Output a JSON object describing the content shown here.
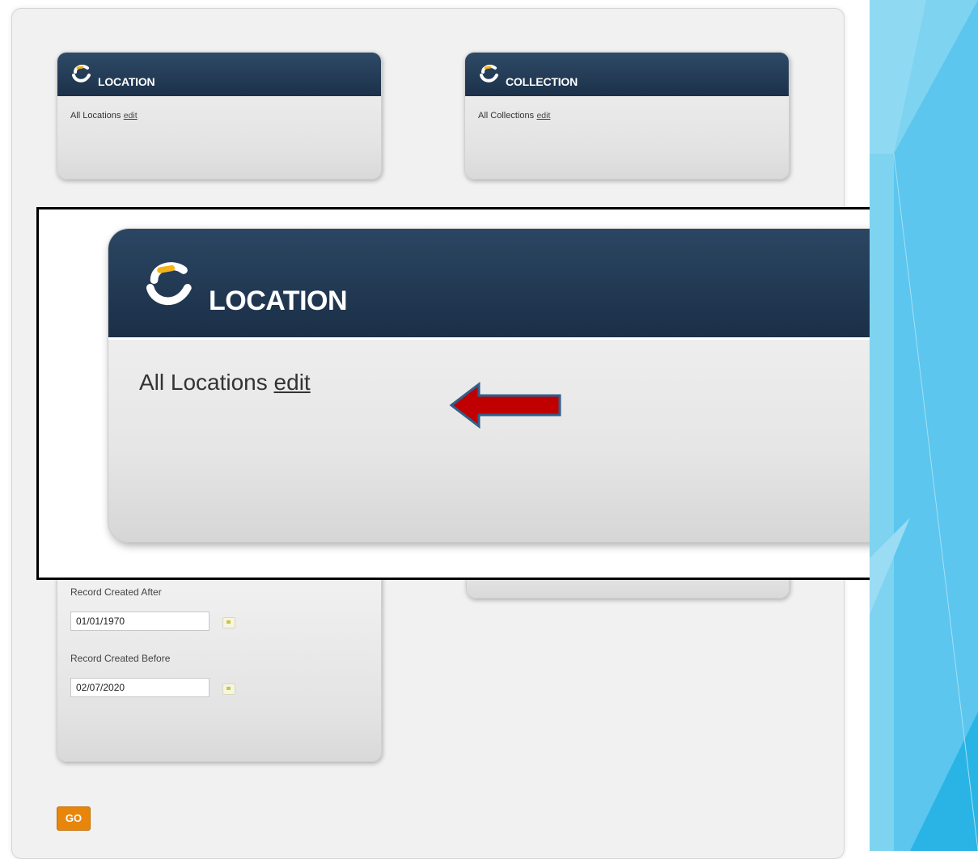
{
  "location_widget": {
    "title": "LOCATION",
    "text": "All Locations",
    "edit_label": "edit"
  },
  "collection_widget": {
    "title": "COLLECTION",
    "text": "All Collections",
    "edit_label": "edit"
  },
  "zoom_callout": {
    "title": "LOCATION",
    "text": "All Locations",
    "edit_label": "edit"
  },
  "dates": {
    "created_after_label": "Record Created After",
    "created_after_value": "01/01/1970",
    "created_before_label": "Record Created Before",
    "created_before_value": "02/07/2020"
  },
  "go_label": "GO",
  "colors": {
    "header": "#1f3550",
    "logo_accent": "#f2b21a",
    "arrow": "#c00000",
    "go_button": "#e8860c",
    "deco_blue": "#4fc0ea"
  },
  "icons": {
    "logo": "swirl-logo-icon",
    "calendar": "calendar-icon",
    "arrow": "left-arrow-icon"
  }
}
